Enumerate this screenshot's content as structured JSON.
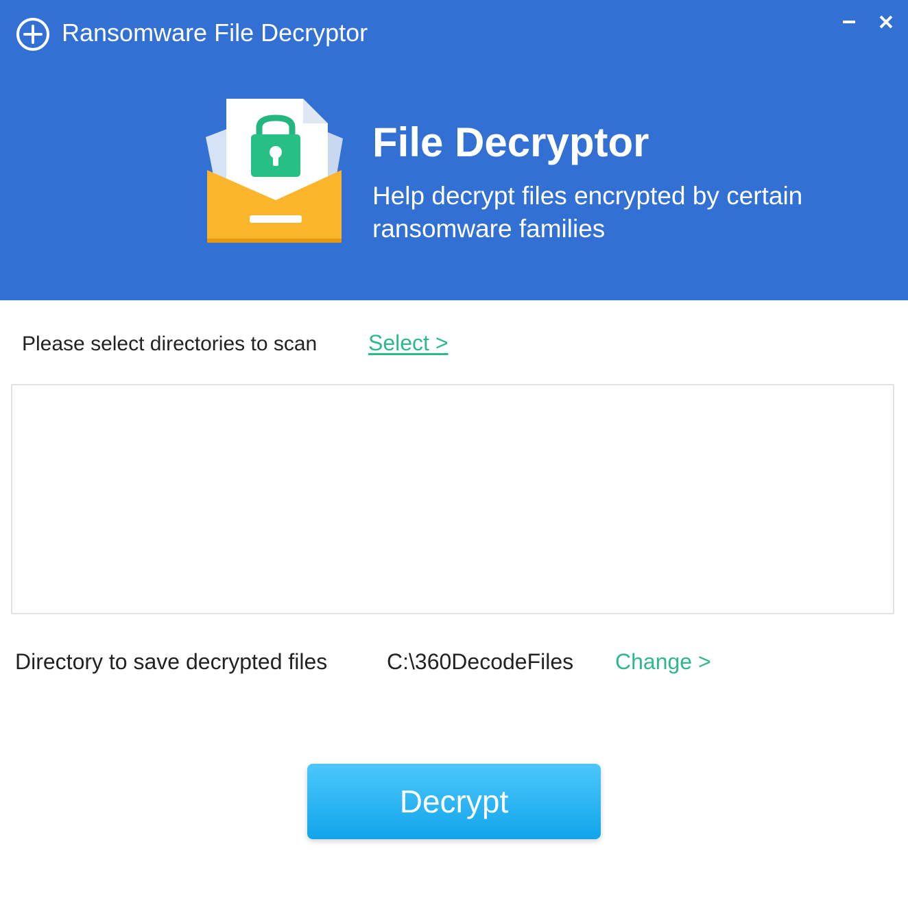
{
  "window": {
    "title": "Ransomware File Decryptor",
    "icon": "plus-circle-icon",
    "controls": {
      "minimize_glyph": "–",
      "close_glyph": "×"
    }
  },
  "hero": {
    "title": "File Decryptor",
    "subtitle": "Help decrypt files encrypted by certain ransomware families",
    "illustration": "locked-envelope-icon"
  },
  "scan": {
    "label": "Please select directories to scan",
    "select_link": "Select >",
    "directories": []
  },
  "save": {
    "label": "Directory to save decrypted files",
    "path": "C:\\360DecodeFiles",
    "change_link": "Change >"
  },
  "actions": {
    "decrypt_label": "Decrypt"
  },
  "colors": {
    "header_bg": "#3370d4",
    "link": "#2fb98a",
    "button_top": "#4cc7fc",
    "button_bottom": "#12a5ea"
  }
}
